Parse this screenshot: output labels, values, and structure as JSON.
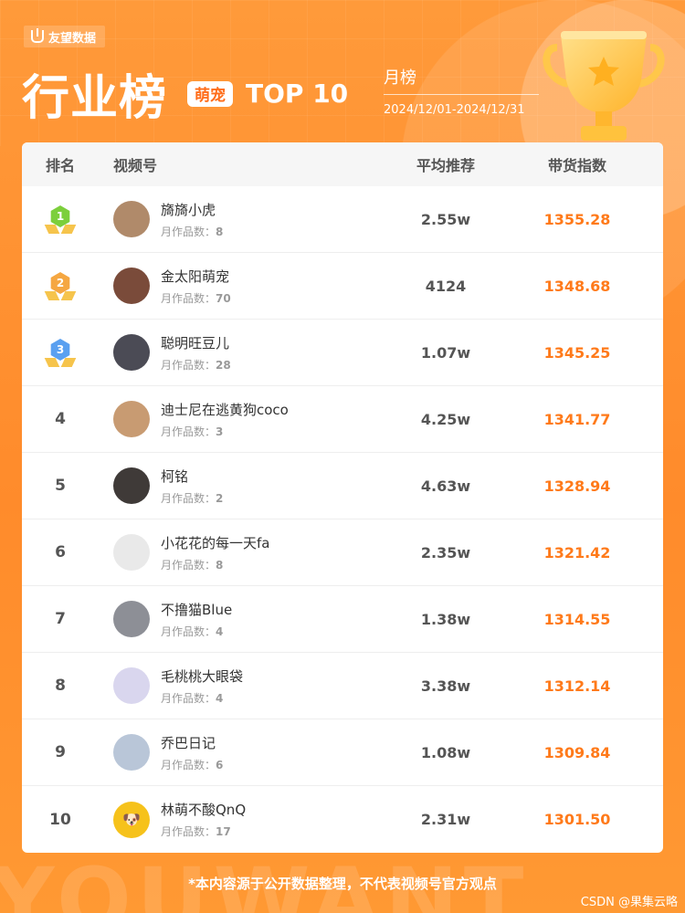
{
  "brand": {
    "name": "友望数据"
  },
  "header": {
    "title": "行业榜",
    "category": "萌宠",
    "top_label": "TOP 10",
    "period_type": "月榜",
    "period_range": "2024/12/01-2024/12/31"
  },
  "table": {
    "columns": {
      "rank": "排名",
      "video": "视频号",
      "recommend": "平均推荐",
      "index": "带货指数"
    },
    "count_label": "月作品数：",
    "rows": [
      {
        "rank": "1",
        "name": "旖旖小虎",
        "works": "8",
        "recommend": "2.55w",
        "index": "1355.28",
        "medal": "gold",
        "avatar_color": "#b08a6a",
        "avatar_icon": ""
      },
      {
        "rank": "2",
        "name": "金太阳萌宠",
        "works": "70",
        "recommend": "4124",
        "index": "1348.68",
        "medal": "silver",
        "avatar_color": "#7a4b3a",
        "avatar_icon": ""
      },
      {
        "rank": "3",
        "name": "聪明旺豆儿",
        "works": "28",
        "recommend": "1.07w",
        "index": "1345.25",
        "medal": "bronze",
        "avatar_color": "#4b4b55",
        "avatar_icon": ""
      },
      {
        "rank": "4",
        "name": "迪士尼在逃黄狗coco",
        "works": "3",
        "recommend": "4.25w",
        "index": "1341.77",
        "medal": "",
        "avatar_color": "#c89b72",
        "avatar_icon": ""
      },
      {
        "rank": "5",
        "name": "柯铭",
        "works": "2",
        "recommend": "4.63w",
        "index": "1328.94",
        "medal": "",
        "avatar_color": "#3f3a38",
        "avatar_icon": ""
      },
      {
        "rank": "6",
        "name": "小花花的每一天fa",
        "works": "8",
        "recommend": "2.35w",
        "index": "1321.42",
        "medal": "",
        "avatar_color": "#e9e9e9",
        "avatar_icon": ""
      },
      {
        "rank": "7",
        "name": "不撸猫Blue",
        "works": "4",
        "recommend": "1.38w",
        "index": "1314.55",
        "medal": "",
        "avatar_color": "#8d8f96",
        "avatar_icon": ""
      },
      {
        "rank": "8",
        "name": "毛桃桃大眼袋",
        "works": "4",
        "recommend": "3.38w",
        "index": "1312.14",
        "medal": "",
        "avatar_color": "#d9d6ee",
        "avatar_icon": ""
      },
      {
        "rank": "9",
        "name": "乔巴日记",
        "works": "6",
        "recommend": "1.08w",
        "index": "1309.84",
        "medal": "",
        "avatar_color": "#b9c6d8",
        "avatar_icon": ""
      },
      {
        "rank": "10",
        "name": "林萌不酸QnQ",
        "works": "17",
        "recommend": "2.31w",
        "index": "1301.50",
        "medal": "",
        "avatar_color": "#f6c21b",
        "avatar_icon": "🐶"
      }
    ]
  },
  "footer": {
    "watermark": "YOUWANT",
    "note": "*本内容源于公开数据整理，不代表视频号官方观点",
    "source": "CSDN @果集云略"
  }
}
